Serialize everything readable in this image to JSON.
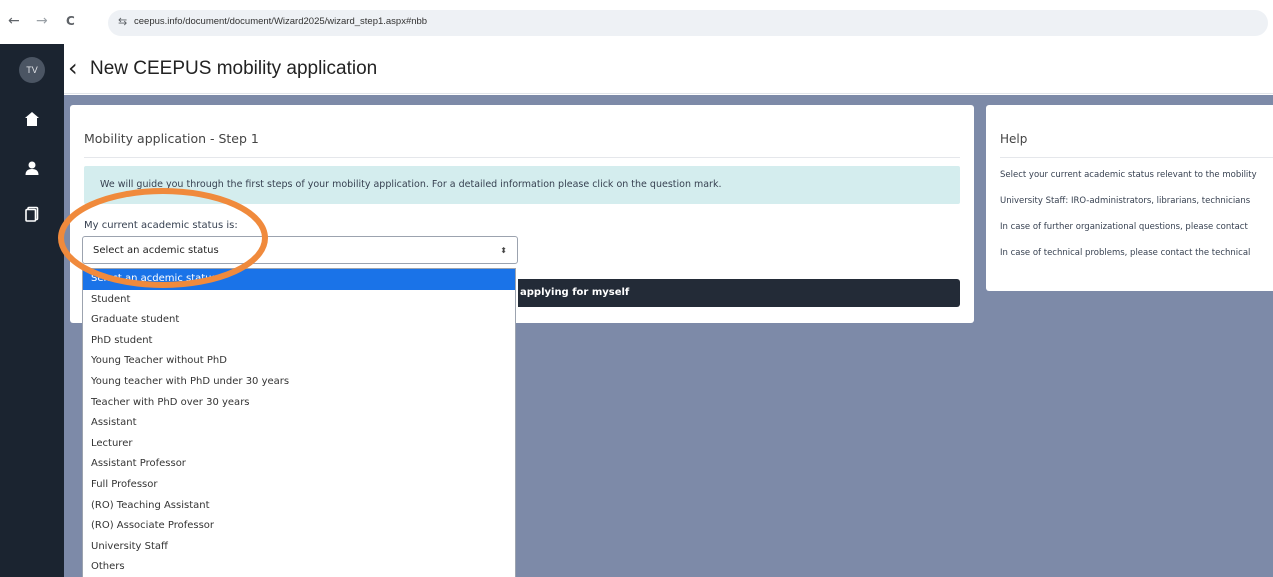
{
  "browser": {
    "back_glyph": "←",
    "forward_glyph": "→",
    "reload_glyph": "C",
    "site_icon_glyph": "⇆",
    "url": "ceepus.info/document/document/Wizard2025/wizard_step1.aspx#nbb"
  },
  "sidebar": {
    "avatar_initials": "TV",
    "icons": [
      "home-icon",
      "user-icon",
      "document-icon"
    ]
  },
  "header": {
    "back_glyph": "‹",
    "title": "New CEEPUS mobility application"
  },
  "step_card": {
    "title": "Mobility application - Step 1",
    "info_text": "We will guide you through the first steps of your mobility application. For a detailed information please click on the question mark.",
    "status_label": "My current academic status is:",
    "select": {
      "value": "Select an acdemic status",
      "arrow_glyph": "⬍"
    },
    "apply_button_label": "applying for myself"
  },
  "help_card": {
    "title": "Help",
    "lines": [
      "Select your current academic status relevant to the mobility",
      "University Staff: IRO-administrators, librarians, technicians",
      "In case of further organizational questions, please contact",
      "In case of technical problems, please contact the technical"
    ]
  },
  "dropdown": {
    "options": [
      "Select an acdemic status",
      "Student",
      "Graduate student",
      "PhD student",
      "Young Teacher without PhD",
      "Young teacher with PhD under 30 years",
      "Teacher with PhD over 30 years",
      "Assistant",
      "Lecturer",
      "Assistant Professor",
      "Full Professor",
      "(RO) Teaching Assistant",
      "(RO) Associate Professor",
      "University Staff",
      "Others"
    ],
    "selected_index": 0
  },
  "colors": {
    "sidebar": "#1b2430",
    "main_background": "#7d8aa8",
    "info_background": "#d4edee",
    "selected_option": "#1a73e8",
    "annotation": "#f08a3c"
  }
}
